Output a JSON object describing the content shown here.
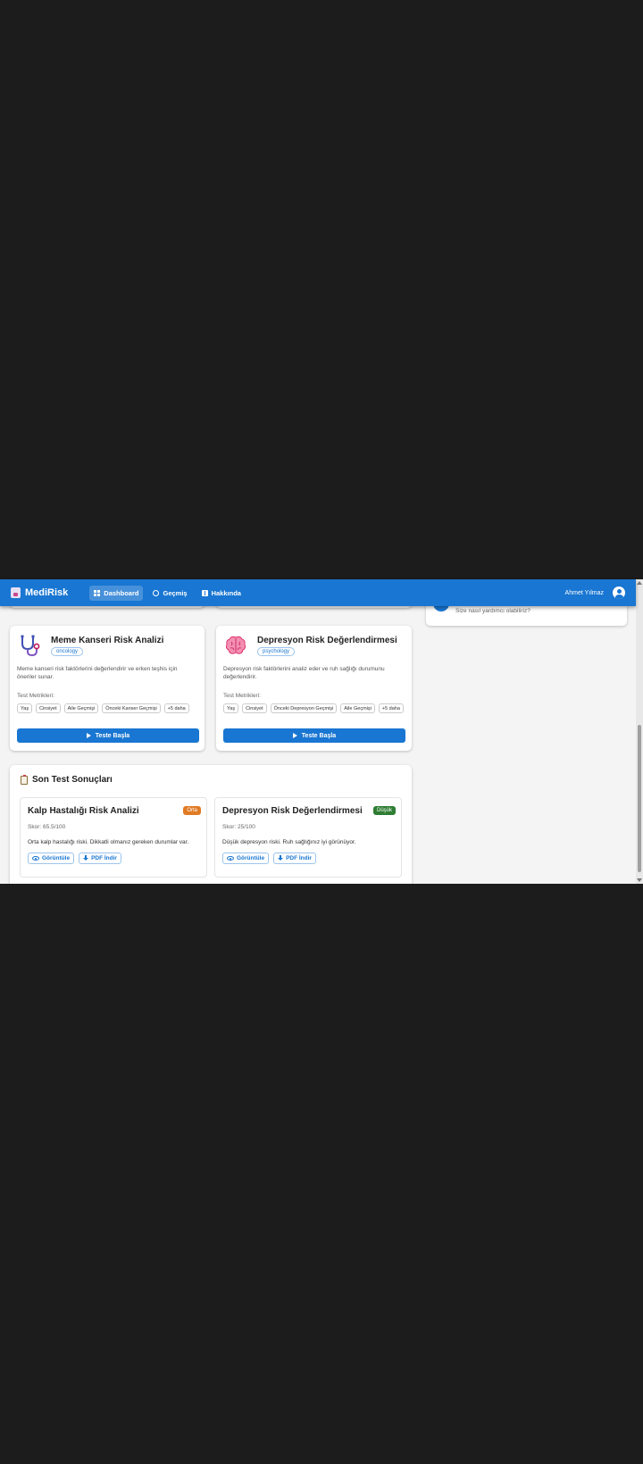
{
  "app": {
    "brand": "MediRisk",
    "brand_icon": "book-icon"
  },
  "nav": [
    {
      "label": "Dashboard",
      "icon": "dashboard-icon",
      "active": true
    },
    {
      "label": "Geçmiş",
      "icon": "history-icon",
      "active": false
    },
    {
      "label": "Hakkında",
      "icon": "info-icon",
      "active": false
    }
  ],
  "user": {
    "name": "Ahmet Yılmaz"
  },
  "side": {
    "text": "Size nasıl yardımcı olabiliriz?"
  },
  "tests": [
    {
      "title": "Meme Kanseri Risk Analizi",
      "category": "oncology",
      "icon": "stethoscope-icon",
      "description": "Meme kanseri risk faktörlerini değerlendirir ve erken teşhis için öneriler sunar.",
      "metrics_label": "Test Metrikleri:",
      "tags": [
        "Yaş",
        "Cinsiyet",
        "Aile Geçmişi",
        "Önceki Kanser Geçmişi",
        "+5 daha"
      ],
      "start_label": "Teste Başla"
    },
    {
      "title": "Depresyon Risk Değerlendirmesi",
      "category": "psychology",
      "icon": "brain-icon",
      "description": "Depresyon risk faktörlerini analiz eder ve ruh sağlığı durumunu değerlendirir.",
      "metrics_label": "Test Metrikleri:",
      "tags": [
        "Yaş",
        "Cinsiyet",
        "Önceki Depresyon Geçmişi",
        "Aile Geçmişi",
        "+5 daha"
      ],
      "start_label": "Teste Başla"
    }
  ],
  "results": {
    "title": "Son Test Sonuçları",
    "items": [
      {
        "title": "Kalp Hastalığı Risk Analizi",
        "badge": "Orta",
        "badge_color": "#e07b24",
        "score": "Skor: 65.5/100",
        "summary": "Orta kalp hastalığı riski. Dikkatli olmanız gereken durumlar var.",
        "view_label": "Görüntüle",
        "pdf_label": "PDF İndir"
      },
      {
        "title": "Depresyon Risk Değerlendirmesi",
        "badge": "Düşük",
        "badge_color": "#2e7d32",
        "score": "Skor: 25/100",
        "summary": "Düşük depresyon riski. Ruh sağlığınız iyi görünüyor.",
        "view_label": "Görüntüle",
        "pdf_label": "PDF İndir"
      }
    ]
  },
  "colors": {
    "primary": "#1976d2",
    "background": "#f4f4f4",
    "outer": "#1c1c1c"
  }
}
